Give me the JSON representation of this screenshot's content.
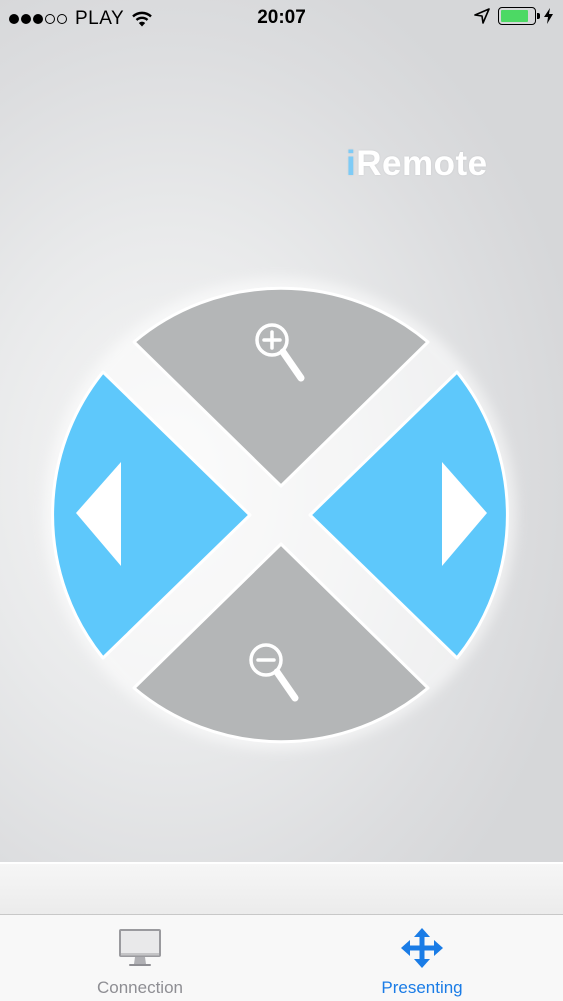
{
  "status_bar": {
    "carrier": "PLAY",
    "time": "20:07",
    "signal_strength": 3,
    "signal_max": 5,
    "icons": [
      "signal-dots-icon",
      "wifi-icon",
      "location-arrow-icon",
      "battery-icon",
      "charging-bolt-icon"
    ],
    "battery_level": 0.85
  },
  "app": {
    "logo_i": "i",
    "logo_rest": "Remote",
    "logo_accent_color": "#7ecbf6"
  },
  "control_pad": {
    "zoom_in": {
      "icon": "zoom-in-icon"
    },
    "zoom_out": {
      "icon": "zoom-out-icon"
    },
    "previous": {
      "icon": "arrow-left-icon"
    },
    "next": {
      "icon": "arrow-right-icon"
    },
    "colors": {
      "blue": "#5ec8fb",
      "gray": "#b4b6b7"
    }
  },
  "tab_bar": {
    "tabs": [
      {
        "label": "Connection",
        "icon": "monitor-icon",
        "selected": false
      },
      {
        "label": "Presenting",
        "icon": "move-arrows-icon",
        "selected": true
      }
    ],
    "active_color": "#1a7ce6",
    "inactive_color": "#8e8e93"
  }
}
